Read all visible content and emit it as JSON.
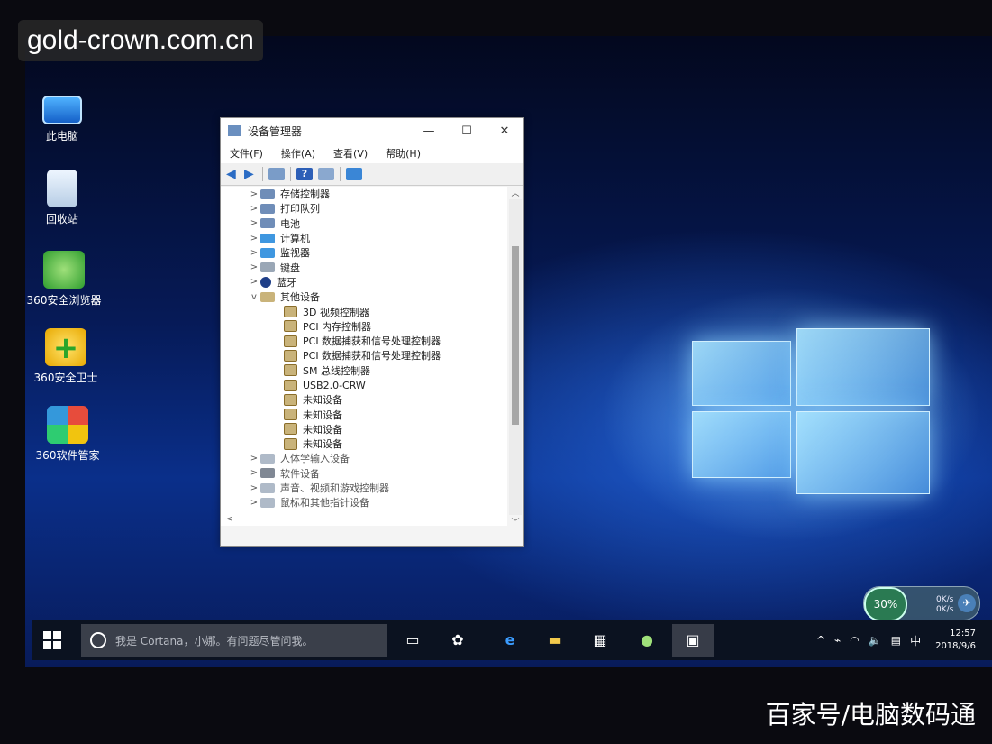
{
  "watermark_top": "gold-crown.com.cn",
  "watermark_bottom": "百家号/电脑数码通",
  "desktop": {
    "icons": [
      {
        "label": "此电脑",
        "icon": "computer-icon"
      },
      {
        "label": "回收站",
        "icon": "recycle-bin-icon"
      },
      {
        "label": "360安全浏览器",
        "icon": "browser-icon"
      },
      {
        "label": "360安全卫士",
        "icon": "security-guard-icon"
      },
      {
        "label": "360软件管家",
        "icon": "software-manager-icon"
      }
    ]
  },
  "device_manager": {
    "title": "设备管理器",
    "menu": [
      "文件(F)",
      "操作(A)",
      "查看(V)",
      "帮助(H)"
    ],
    "tree": [
      {
        "label": "存储控制器",
        "level": 0,
        "expander": ">"
      },
      {
        "label": "打印队列",
        "level": 0,
        "expander": ">"
      },
      {
        "label": "电池",
        "level": 0,
        "expander": ">"
      },
      {
        "label": "计算机",
        "level": 0,
        "expander": ">"
      },
      {
        "label": "监视器",
        "level": 0,
        "expander": ">"
      },
      {
        "label": "键盘",
        "level": 0,
        "expander": ">"
      },
      {
        "label": "蓝牙",
        "level": 0,
        "expander": ">"
      },
      {
        "label": "其他设备",
        "level": 0,
        "expander": "v"
      },
      {
        "label": "3D 视频控制器",
        "level": 1
      },
      {
        "label": "PCI 内存控制器",
        "level": 1
      },
      {
        "label": "PCI 数据捕获和信号处理控制器",
        "level": 1
      },
      {
        "label": "PCI 数据捕获和信号处理控制器",
        "level": 1
      },
      {
        "label": "SM 总线控制器",
        "level": 1
      },
      {
        "label": "USB2.0-CRW",
        "level": 1
      },
      {
        "label": "未知设备",
        "level": 1
      },
      {
        "label": "未知设备",
        "level": 1
      },
      {
        "label": "未知设备",
        "level": 1
      },
      {
        "label": "未知设备",
        "level": 1
      },
      {
        "label": "人体学输入设备",
        "level": 0,
        "expander": ">"
      },
      {
        "label": "软件设备",
        "level": 0,
        "expander": ">"
      },
      {
        "label": "声音、视频和游戏控制器",
        "level": 0,
        "expander": ">"
      },
      {
        "label": "鼠标和其他指针设备",
        "level": 0,
        "expander": ">"
      }
    ]
  },
  "widget": {
    "percent": "30%",
    "up": "0K/s",
    "down": "0K/s"
  },
  "taskbar": {
    "search_placeholder": "我是 Cortana，小娜。有问题尽管问我。",
    "tray_ime": "中",
    "time": "12:57",
    "date": "2018/9/6"
  }
}
